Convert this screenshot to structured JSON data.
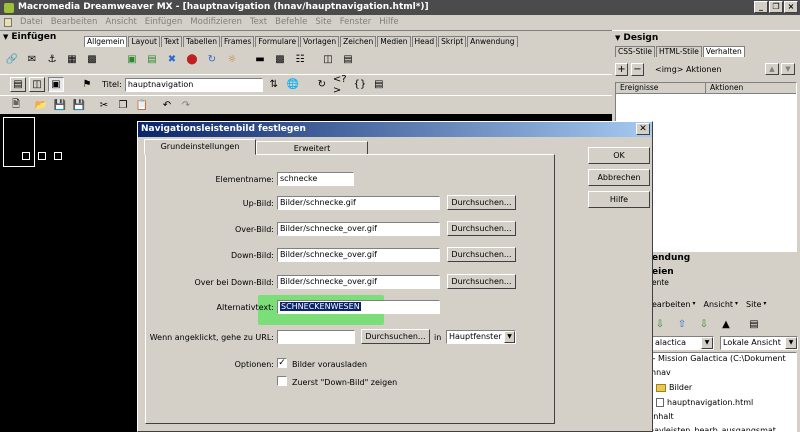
{
  "app": {
    "title": "Macromedia Dreamweaver MX - [hauptnavigation (hnav/hauptnavigation.html*)]",
    "win_min": "_",
    "win_restore": "❐",
    "win_close": "×"
  },
  "menu": [
    "Datei",
    "Bearbeiten",
    "Ansicht",
    "Einfügen",
    "Modifizieren",
    "Text",
    "Befehle",
    "Site",
    "Fenster",
    "Hilfe"
  ],
  "insert_panel": {
    "title": "Einfügen",
    "tabs": [
      "Allgemein",
      "Layout",
      "Text",
      "Tabellen",
      "Frames",
      "Formulare",
      "Vorlagen",
      "Zeichen",
      "Medien",
      "Head",
      "Skript",
      "Anwendung"
    ],
    "active_tab": "Allgemein"
  },
  "doc_toolbar": {
    "title_label": "Titel:",
    "title_value": "hauptnavigation"
  },
  "design_panel": {
    "title": "Design",
    "tabs": [
      "CSS-Stile",
      "HTML-Stile",
      "Verhalten"
    ],
    "tag_label": "<img> Aktionen",
    "col_events": "Ereignisse",
    "col_actions": "Aktionen"
  },
  "files_panel": {
    "partial_title_1": "endung",
    "partial_title_2": "eien",
    "partial_tab": "ente",
    "menu_edit": "earbeiten",
    "menu_view": "Ansicht",
    "menu_site": "Site",
    "site_select": "alactica",
    "view_select": "Lokale Ansicht",
    "tree": [
      {
        "label": "te - Mission Galactica (C:\\Dokument",
        "type": "root"
      },
      {
        "label": "hnav",
        "type": "folder"
      },
      {
        "label": "Bilder",
        "type": "folder"
      },
      {
        "label": "hauptnavigation.html",
        "type": "file"
      },
      {
        "label": "inhalt",
        "type": "folder"
      },
      {
        "label": "navleisten_bearb_ausgangsmat",
        "type": "file"
      }
    ]
  },
  "dialog": {
    "title": "Navigationsleistenbild festlegen",
    "tabs": [
      "Grundeinstellungen",
      "Erweitert"
    ],
    "fields": {
      "elementname_label": "Elementname:",
      "elementname_value": "schnecke",
      "up_label": "Up-Bild:",
      "up_value": "Bilder/schnecke.gif",
      "over_label": "Over-Bild:",
      "over_value": "Bilder/schnecke_over.gif",
      "down_label": "Down-Bild:",
      "down_value": "Bilder/schnecke_over.gif",
      "overdown_label": "Over bei Down-Bild:",
      "overdown_value": "Bilder/schnecke_over.gif",
      "alt_label": "Alternativtext:",
      "alt_value": "SCHNECKENWESEN",
      "url_label": "Wenn angeklickt, gehe zu URL:",
      "url_value": "",
      "in_label": "in",
      "target_value": "Hauptfenster",
      "options_label": "Optionen:",
      "preload_label": "Bilder vorausladen",
      "showdown_label": "Zuerst \"Down-Bild\" zeigen"
    },
    "browse_label": "Durchsuchen...",
    "ok": "OK",
    "cancel": "Abbrechen",
    "help": "Hilfe",
    "highlight_color": "#5ee35e"
  }
}
